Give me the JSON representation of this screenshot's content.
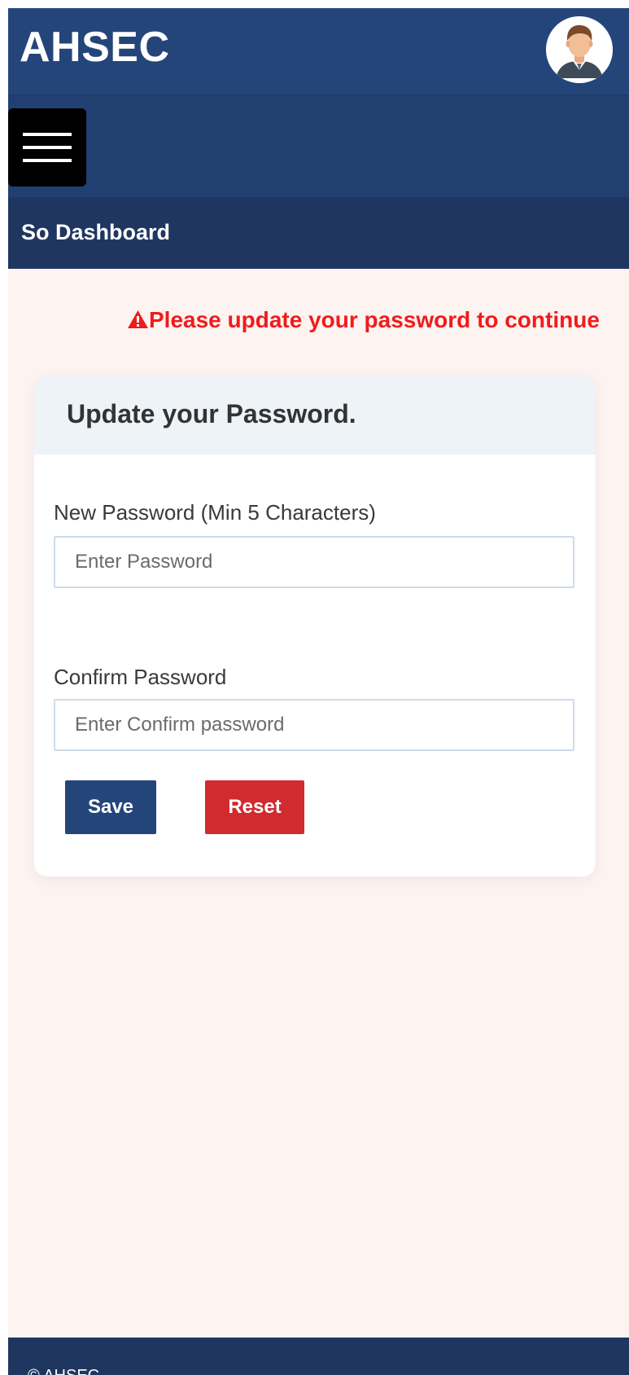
{
  "header": {
    "brand": "AHSEC",
    "avatar_icon": "user-avatar-icon",
    "color": "#24457a"
  },
  "nav": {
    "menu_icon": "hamburger-menu-icon"
  },
  "breadcrumb": {
    "title": "So Dashboard"
  },
  "alert": {
    "icon": "warning-triangle-icon",
    "message": "Please update your password to continue",
    "color": "#ef1c1c"
  },
  "form": {
    "title": "Update your Password.",
    "new_password": {
      "label": "New Password (Min 5 Characters)",
      "placeholder": "Enter Password",
      "value": ""
    },
    "confirm_password": {
      "label": "Confirm Password",
      "placeholder": "Enter Confirm password",
      "value": ""
    },
    "save_label": "Save",
    "reset_label": "Reset",
    "save_color": "#24457a",
    "reset_color": "#d12a2f"
  },
  "footer": {
    "text": "© AHSEC"
  }
}
